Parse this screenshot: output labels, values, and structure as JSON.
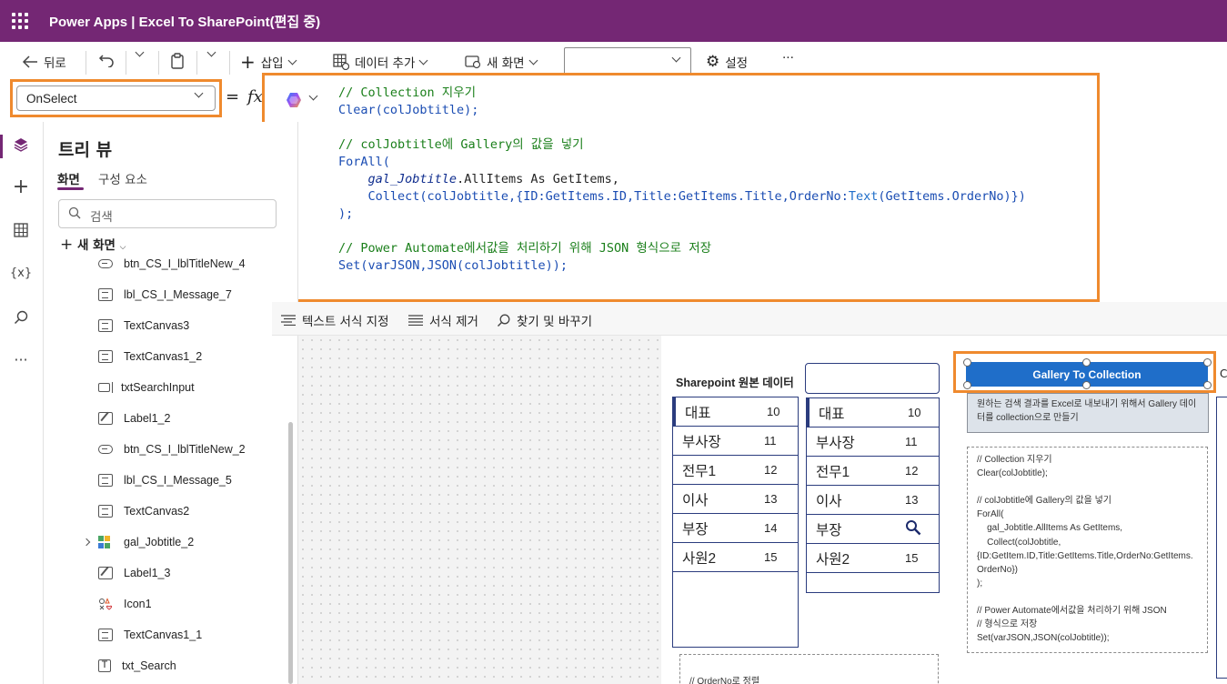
{
  "app": {
    "title": "Power Apps  |  Excel To SharePoint(편집 중)"
  },
  "toolbar": {
    "back": "뒤로",
    "insert": "삽입",
    "add_data": "데이터 추가",
    "new_screen": "새 화면",
    "settings": "설정",
    "more": "···",
    "screen_select": ""
  },
  "formula": {
    "property": "OnSelect",
    "equals": "=",
    "fx": "fx"
  },
  "code": {
    "l1": "// Collection 지우기",
    "l2": "Clear(colJobtitle);",
    "l4": "// colJobtitle에 Gallery의 값을 넣기",
    "l5": "ForAll(",
    "l6a": "gal_Jobtitle",
    "l6b": ".AllItems As GetItems,",
    "l7a": "Collect(colJobtitle,{ID:GetItems.ID,Title:GetItems.Title,OrderNo:",
    "l7b": "Text",
    "l7c": "(GetItems.OrderNo)})",
    "l8": ");",
    "l10": "// Power Automate에서값을 처리하기 위해 JSON 형식으로 저장",
    "l11": "Set(varJSON,JSON(colJobtitle));"
  },
  "rail": {
    "icons": [
      "layers-icon",
      "plus-icon",
      "table-icon",
      "variables-icon",
      "search-icon",
      "more-icon"
    ],
    "variables": "{x}"
  },
  "tree": {
    "title": "트리 뷰",
    "tabs": [
      "화면",
      "구성 요소"
    ],
    "search_placeholder": "검색",
    "new_screen": "새 화면",
    "items": [
      {
        "label": "btn_CS_I_lblTitleNew_4",
        "icon": "button"
      },
      {
        "label": "lbl_CS_I_Message_7",
        "icon": "text"
      },
      {
        "label": "TextCanvas3",
        "icon": "text"
      },
      {
        "label": "TextCanvas1_2",
        "icon": "text"
      },
      {
        "label": "txtSearchInput",
        "icon": "input"
      },
      {
        "label": "Label1_2",
        "icon": "edit"
      },
      {
        "label": "btn_CS_I_lblTitleNew_2",
        "icon": "button"
      },
      {
        "label": "lbl_CS_I_Message_5",
        "icon": "text"
      },
      {
        "label": "TextCanvas2",
        "icon": "text"
      },
      {
        "label": "gal_Jobtitle_2",
        "icon": "gallery"
      },
      {
        "label": "Label1_3",
        "icon": "edit"
      },
      {
        "label": "Icon1",
        "icon": "iconctl"
      },
      {
        "label": "TextCanvas1_1",
        "icon": "text"
      },
      {
        "label": "txt_Search",
        "icon": "textinput"
      }
    ]
  },
  "format_bar": {
    "format_text": "텍스트 서식 지정",
    "remove_format": "서식 제거",
    "find_replace": "찾기 및 바꾸기"
  },
  "canvas": {
    "sp_title": "Sharepoint 원본 데이터",
    "gallery1": [
      {
        "t": "대표",
        "n": "10"
      },
      {
        "t": "부사장",
        "n": "11"
      },
      {
        "t": "전무1",
        "n": "12"
      },
      {
        "t": "이사",
        "n": "13"
      },
      {
        "t": "부장",
        "n": "14"
      },
      {
        "t": "사원2",
        "n": "15"
      }
    ],
    "gallery2": [
      {
        "t": "대표",
        "n": "10"
      },
      {
        "t": "부사장",
        "n": "11"
      },
      {
        "t": "전무1",
        "n": "12"
      },
      {
        "t": "이사",
        "n": "13"
      },
      {
        "t": "부장",
        "n": ""
      },
      {
        "t": "사원2",
        "n": "15"
      }
    ],
    "button": "Gallery To Collection",
    "desc": "원하는 검색 결과를 Excel로 내보내기 위해서 Gallery 데이터를 collection으로 만들기",
    "code_label": "// Collection 지우기\nClear(colJobtitle);\n\n// colJobtitle에 Gallery의 값을 넣기\nForAll(\n    gal_Jobtitle.AllItems As GetItems,\n    Collect(colJobtitle,\n{ID:GetItem.ID,Title:GetItems.Title,OrderNo:GetItems.\nOrderNo})\n);\n\n// Power Automate에서값을 처리하기 위해 JSON\n// 형식으로 저장\nSet(varJSON,JSON(colJobtitle));",
    "sort_label": "// OrderNo로 정렬",
    "c_frag": "C"
  }
}
